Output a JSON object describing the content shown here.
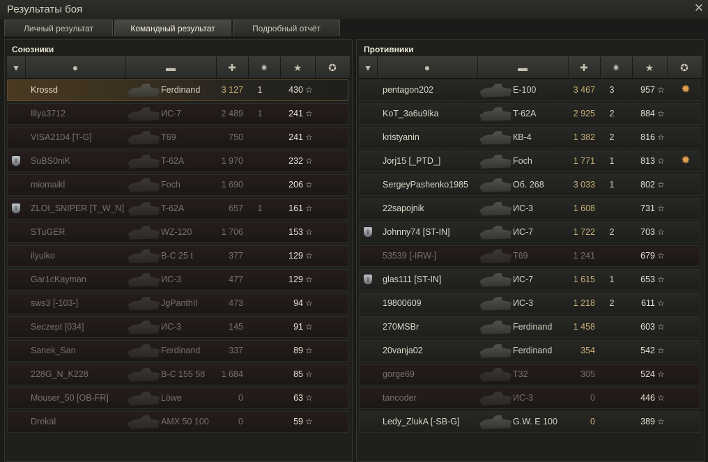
{
  "window": {
    "title": "Результаты боя",
    "close": "✕"
  },
  "tabs": [
    {
      "label": "Личный результат"
    },
    {
      "label": "Командный результат"
    },
    {
      "label": "Подробный отчёт"
    }
  ],
  "active_tab": 1,
  "icons": {
    "rank": "rank-icon",
    "player": "player-icon",
    "tank": "tank-icon",
    "damage": "damage-icon",
    "kills": "kills-icon",
    "xp": "star-icon",
    "medal": "medal-icon"
  },
  "allies": {
    "title": "Союзники",
    "rows": [
      {
        "name": "Krossd",
        "vehicle": "Ferdinand",
        "damage": "3 127",
        "kills": "1",
        "xp": "430",
        "badge": "",
        "dead": false,
        "me": true
      },
      {
        "name": "Illya3712",
        "vehicle": "ИС-7",
        "damage": "2 489",
        "kills": "1",
        "xp": "241",
        "badge": "",
        "dead": true
      },
      {
        "name": "VISA2104 [T-G]",
        "vehicle": "T69",
        "damage": "750",
        "kills": "",
        "xp": "241",
        "badge": "",
        "dead": true
      },
      {
        "name": "SuBS0niK",
        "vehicle": "T-62A",
        "damage": "1 970",
        "kills": "",
        "xp": "232",
        "badge": "I",
        "dead": true
      },
      {
        "name": "miomaikl",
        "vehicle": "Foch",
        "damage": "1 690",
        "kills": "",
        "xp": "206",
        "badge": "",
        "dead": true
      },
      {
        "name": "ZLOI_SNIPER [T_W_N]",
        "vehicle": "T-62A",
        "damage": "657",
        "kills": "1",
        "xp": "161",
        "badge": "I",
        "dead": true
      },
      {
        "name": "STuGER",
        "vehicle": "WZ-120",
        "damage": "1 706",
        "kills": "",
        "xp": "153",
        "badge": "",
        "dead": true
      },
      {
        "name": "ilyulko",
        "vehicle": "B-C 25 t",
        "damage": "377",
        "kills": "",
        "xp": "129",
        "badge": "",
        "dead": true
      },
      {
        "name": "Gar1cKayman",
        "vehicle": "ИС-3",
        "damage": "477",
        "kills": "",
        "xp": "129",
        "badge": "",
        "dead": true
      },
      {
        "name": "sws3 [-103-]",
        "vehicle": "JgPanthII",
        "damage": "473",
        "kills": "",
        "xp": "94",
        "badge": "",
        "dead": true
      },
      {
        "name": "Seczept [034]",
        "vehicle": "ИС-3",
        "damage": "145",
        "kills": "",
        "xp": "91",
        "badge": "",
        "dead": true
      },
      {
        "name": "Sanek_San",
        "vehicle": "Ferdinand",
        "damage": "337",
        "kills": "",
        "xp": "89",
        "badge": "",
        "dead": true
      },
      {
        "name": "228G_N_K228",
        "vehicle": "B-C 155 58",
        "damage": "1 684",
        "kills": "",
        "xp": "85",
        "badge": "",
        "dead": true
      },
      {
        "name": "Mouser_50 [OB-FR]",
        "vehicle": "Löwe",
        "damage": "0",
        "kills": "",
        "xp": "63",
        "badge": "",
        "dead": true
      },
      {
        "name": "Drekal",
        "vehicle": "AMX 50 100",
        "damage": "0",
        "kills": "",
        "xp": "59",
        "badge": "",
        "dead": true
      }
    ]
  },
  "enemies": {
    "title": "Противники",
    "rows": [
      {
        "name": "pentagon202",
        "vehicle": "E-100",
        "damage": "3 467",
        "kills": "3",
        "xp": "957",
        "badge": "",
        "dead": false,
        "medal": "✹"
      },
      {
        "name": "KoT_3a6u9lka",
        "vehicle": "T-62A",
        "damage": "2 925",
        "kills": "2",
        "xp": "884",
        "badge": "",
        "dead": false
      },
      {
        "name": "kristyanin",
        "vehicle": "КВ-4",
        "damage": "1 382",
        "kills": "2",
        "xp": "816",
        "badge": "",
        "dead": false
      },
      {
        "name": "Jorj15 [_PTD_]",
        "vehicle": "Foch",
        "damage": "1 771",
        "kills": "1",
        "xp": "813",
        "badge": "",
        "dead": false,
        "medal": "✹"
      },
      {
        "name": "SergeyPashenko1985",
        "vehicle": "Об. 268",
        "damage": "3 033",
        "kills": "1",
        "xp": "802",
        "badge": "",
        "dead": false
      },
      {
        "name": "22sapojnik",
        "vehicle": "ИС-3",
        "damage": "1 608",
        "kills": "",
        "xp": "731",
        "badge": "",
        "dead": false
      },
      {
        "name": "Johnny74 [ST-IN]",
        "vehicle": "ИС-7",
        "damage": "1 722",
        "kills": "2",
        "xp": "703",
        "badge": "I",
        "dead": false
      },
      {
        "name": "53539 [-IRW-]",
        "vehicle": "T69",
        "damage": "1 241",
        "kills": "",
        "xp": "679",
        "badge": "",
        "dead": true
      },
      {
        "name": "glas111 [ST-IN]",
        "vehicle": "ИС-7",
        "damage": "1 615",
        "kills": "1",
        "xp": "653",
        "badge": "I",
        "dead": false
      },
      {
        "name": "19800609",
        "vehicle": "ИС-3",
        "damage": "1 218",
        "kills": "2",
        "xp": "611",
        "badge": "",
        "dead": false
      },
      {
        "name": "270MSBr",
        "vehicle": "Ferdinand",
        "damage": "1 458",
        "kills": "",
        "xp": "603",
        "badge": "",
        "dead": false
      },
      {
        "name": "20vanja02",
        "vehicle": "Ferdinand",
        "damage": "354",
        "kills": "",
        "xp": "542",
        "badge": "",
        "dead": false
      },
      {
        "name": "gorge69",
        "vehicle": "T32",
        "damage": "305",
        "kills": "",
        "xp": "524",
        "badge": "",
        "dead": true
      },
      {
        "name": "tancoder",
        "vehicle": "ИС-3",
        "damage": "0",
        "kills": "",
        "xp": "446",
        "badge": "",
        "dead": true
      },
      {
        "name": "Ledy_ZlukA [-SB-G]",
        "vehicle": "G.W. E 100",
        "damage": "0",
        "kills": "",
        "xp": "389",
        "badge": "",
        "dead": false
      }
    ]
  },
  "star_glyph": "☆"
}
